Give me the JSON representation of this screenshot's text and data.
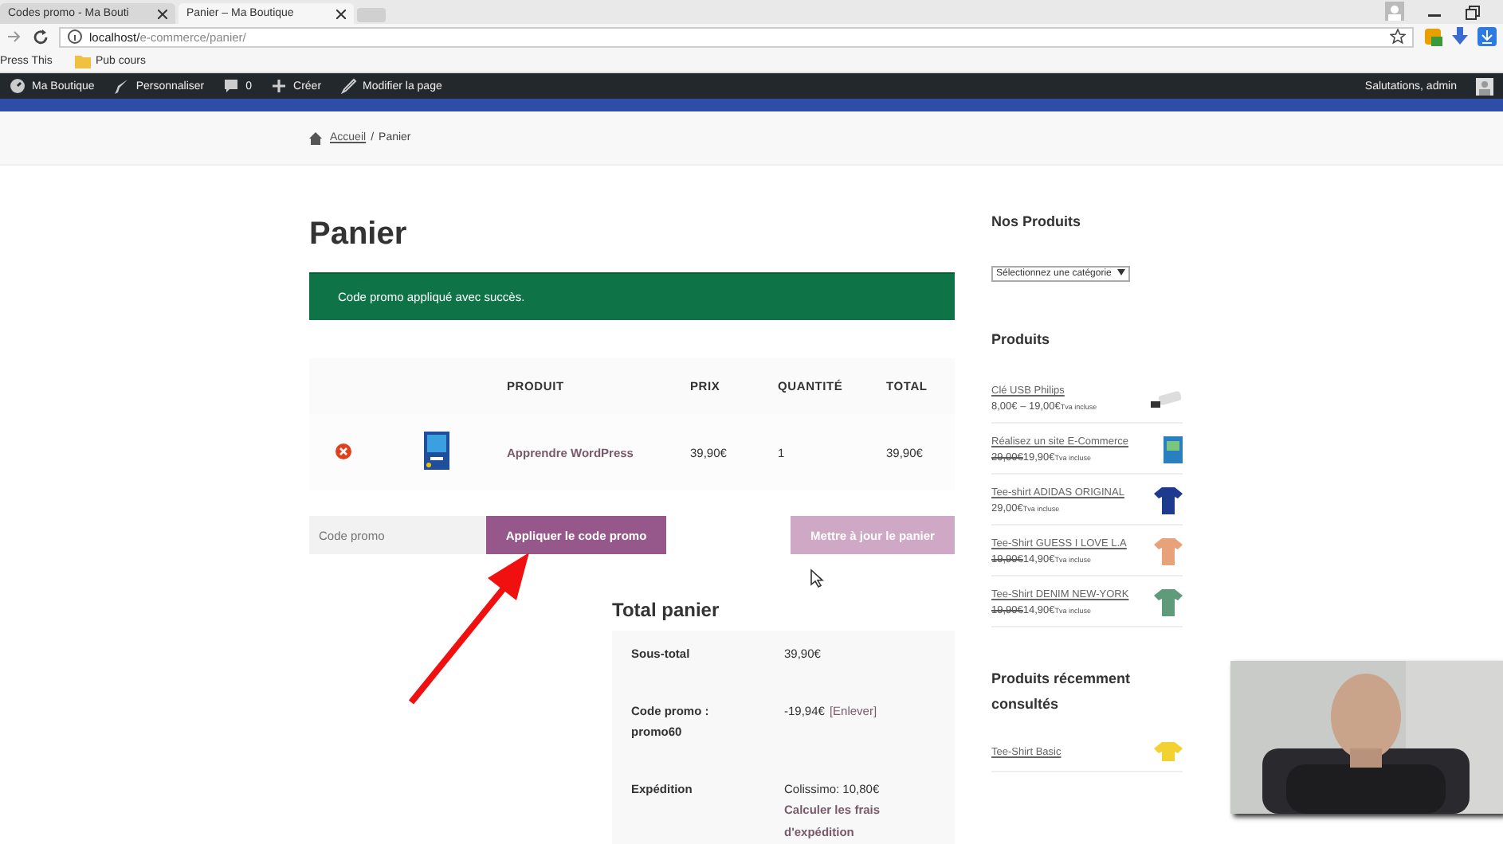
{
  "browser": {
    "tabs": [
      {
        "title": "Codes promo - Ma Bouti",
        "selected": false
      },
      {
        "title": "Panier – Ma Boutique",
        "selected": true
      }
    ],
    "url_host": "localhost/",
    "url_path": "e-commerce/panier/",
    "bookmarks": [
      {
        "kind": "link",
        "label": "Press This"
      },
      {
        "kind": "folder",
        "label": "Pub cours"
      }
    ]
  },
  "admin_bar": {
    "items": [
      {
        "kind": "dashboard",
        "label": "Ma Boutique"
      },
      {
        "kind": "brush",
        "label": "Personnaliser"
      },
      {
        "kind": "comment",
        "label": "0"
      },
      {
        "kind": "plus",
        "label": "Créer"
      },
      {
        "kind": "pencil",
        "label": "Modifier la page"
      }
    ],
    "greeting": "Salutations, admin"
  },
  "breadcrumb": {
    "home": "Accueil",
    "separator": "/",
    "current": "Panier"
  },
  "title": "Panier",
  "notice": "Code promo appliqué avec succès.",
  "cart": {
    "columns": [
      "PRODUIT",
      "PRIX",
      "QUANTITÉ",
      "TOTAL"
    ],
    "rows": [
      {
        "product": "Apprendre WordPress",
        "price": "39,90€",
        "quantity": "1",
        "total": "39,90€"
      }
    ]
  },
  "coupon": {
    "placeholder": "Code promo",
    "apply": "Appliquer le code promo",
    "update": "Mettre à jour le panier",
    "update_disabled": true
  },
  "totals": {
    "title": "Total panier",
    "rows": [
      {
        "label": "Sous-total",
        "value": "39,90€"
      },
      {
        "label": "Code promo : promo60",
        "value": "-19,94€",
        "link": "[Enlever]"
      },
      {
        "label": "Expédition",
        "value": "Colissimo: 10,80€",
        "link": "Calculer les frais d'expédition"
      }
    ]
  },
  "sidebar": {
    "categories_title": "Nos Produits",
    "category_select": "Sélectionnez une catégorie",
    "products_title": "Produits",
    "products": [
      {
        "name": "Clé USB Philips",
        "price": "8,00€ – 19,00€",
        "tax": "Tva incluse",
        "kind": "usb",
        "color": "#dddddd"
      },
      {
        "name": "Réalisez un site E-Commerce",
        "old_price": "29,00€",
        "price": "19,90€",
        "tax": "Tva incluse",
        "kind": "book",
        "color": "#2a7fc0"
      },
      {
        "name": "Tee-shirt ADIDAS ORIGINAL",
        "price": "29,00€",
        "tax": "Tva incluse",
        "kind": "tshirt",
        "color": "#1d3a8f"
      },
      {
        "name": "Tee-Shirt GUESS I LOVE L.A",
        "old_price": "19,90€",
        "price": "14,90€",
        "tax": "Tva incluse",
        "kind": "tshirt",
        "color": "#e8a27a"
      },
      {
        "name": "Tee-Shirt DENIM NEW-YORK",
        "old_price": "19,90€",
        "price": "14,90€",
        "tax": "Tva incluse",
        "kind": "tshirt",
        "color": "#5f9a7a"
      }
    ],
    "recent_title": "Produits récemment consultés",
    "recent": [
      {
        "name": "Tee-Shirt Basic",
        "kind": "tshirt",
        "color": "#f2d230"
      }
    ]
  }
}
